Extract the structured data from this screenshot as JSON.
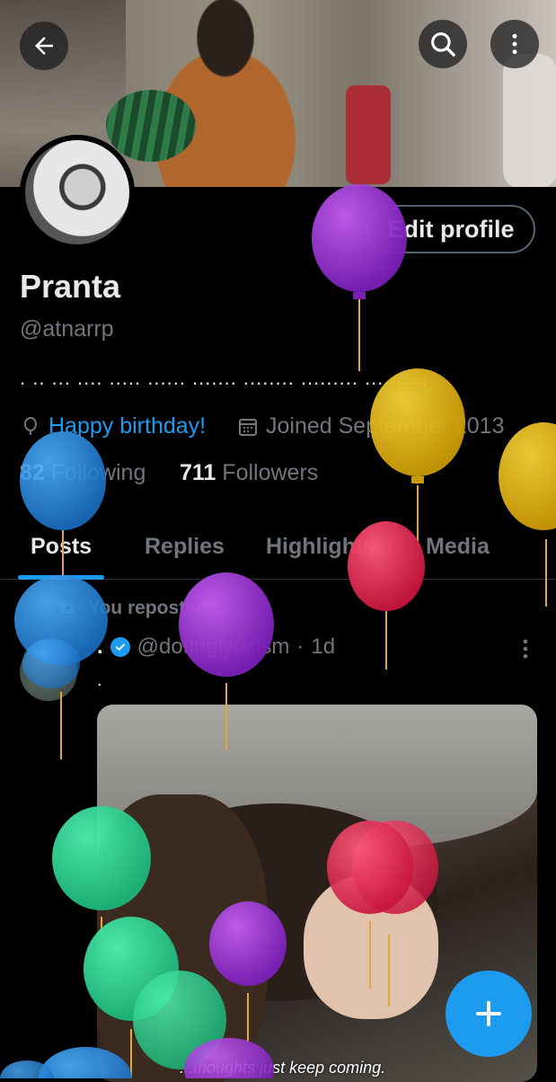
{
  "profile": {
    "name": "Pranta",
    "handle": "@atnarrp",
    "bio": ". .. ... .... ..... ...... ....... ........ ......... ..........",
    "birthday_text": "Happy birthday!",
    "joined_text": "Joined September 2013",
    "following_count": "82",
    "following_label": "Following",
    "followers_count": "711",
    "followers_label": "Followers"
  },
  "header": {
    "edit_profile_label": "Edit profile"
  },
  "tabs": [
    {
      "label": "Posts"
    },
    {
      "label": "Replies"
    },
    {
      "label": "Highlights"
    },
    {
      "label": "Media"
    }
  ],
  "post": {
    "repost_label": "You reposted",
    "author_dot": ".",
    "author_handle": "@dotinglyricism",
    "separator": "·",
    "time": "1d",
    "text": ".",
    "media_subtitle": "...thoughts just keep coming."
  },
  "icons": {
    "back": "back-arrow-icon",
    "search": "search-icon",
    "more": "more-vertical-icon",
    "birthday": "balloon-icon",
    "calendar": "calendar-icon",
    "repost": "repost-icon",
    "verified": "verified-badge-icon",
    "compose": "plus-icon"
  },
  "colors": {
    "accent": "#1d9bf0",
    "background": "#000000",
    "secondary_text": "#71767b"
  }
}
